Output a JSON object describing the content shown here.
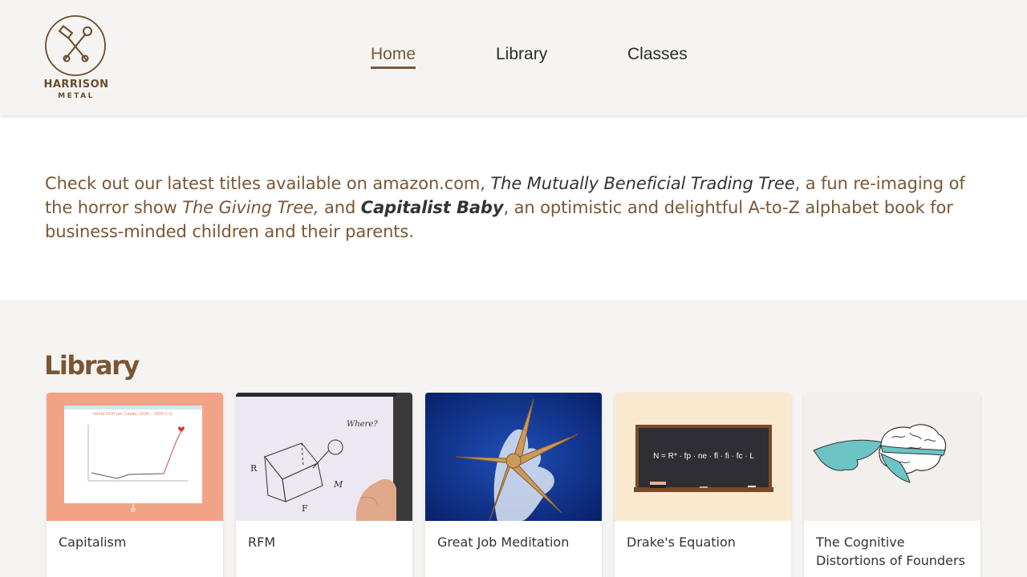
{
  "logo": {
    "name": "HARRISON",
    "sub": "METAL"
  },
  "nav": [
    {
      "label": "Home",
      "active": true
    },
    {
      "label": "Library",
      "active": false
    },
    {
      "label": "Classes",
      "active": false
    }
  ],
  "intro": {
    "p1": "Check out our latest titles available on amazon.com, ",
    "t1": "The Mutually Beneficial Trading Tree",
    "p2": ", a fun re-imaging of the horror show ",
    "t2": "The Giving Tree,",
    "p3": " and ",
    "t3": "Capitalist Baby",
    "p4": ", an optimistic and delightful A-to-Z alphabet book for business-minded children and their parents."
  },
  "library": {
    "title": "Library",
    "cards": [
      {
        "title": "Capitalism",
        "thumb_color": "#f2a386",
        "thumb_icon": "gdp-chart-icon",
        "thumb_caption": "World GDP per Capita, 1500 – 2000 C.E."
      },
      {
        "title": "RFM",
        "thumb_color": "#ece8f2",
        "thumb_icon": "cube-sketch-icon",
        "thumb_caption": "Where?"
      },
      {
        "title": "Great Job Meditation",
        "thumb_color": "#0d2a7a",
        "thumb_icon": "starfish-icon"
      },
      {
        "title": "Drake's Equation",
        "thumb_color": "#fbe9cf",
        "thumb_icon": "chalkboard-icon",
        "thumb_caption": "N = R* · fp · ne · fl · fi · fc · L"
      },
      {
        "title": "The Cognitive Distortions of Founders",
        "thumb_color": "#f3efec",
        "thumb_icon": "brain-cape-icon"
      }
    ]
  },
  "colors": {
    "brand": "#7a5634",
    "band": "#f6f4f2"
  }
}
